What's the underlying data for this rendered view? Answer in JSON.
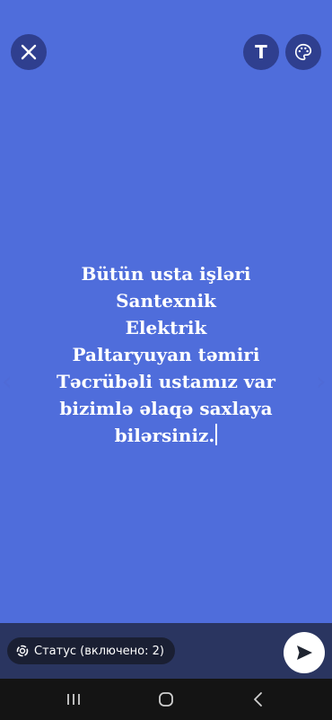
{
  "header": {
    "close_icon": "close-icon",
    "text_tool_label": "T",
    "palette_icon": "palette-icon"
  },
  "status_text": "Bütün usta işləri\nSantexnik\nElektrik\nPaltaryuyan təmiri\nTəcrübəli ustamız var\nbizimlə əlaqə saxlaya\nbilərsiniz.",
  "footer": {
    "audience_label": "Статус (включено: 2)",
    "audience_icon": "status-ring-icon",
    "send_icon": "send-icon"
  },
  "nav": {
    "recents_icon": "recents-icon",
    "home_icon": "home-icon",
    "back_icon": "back-icon"
  },
  "colors": {
    "background": "#4f6ddb",
    "button_bg": "#2f3f8f",
    "bottom_bar": "#2a3560",
    "nav_bar": "#141414"
  }
}
